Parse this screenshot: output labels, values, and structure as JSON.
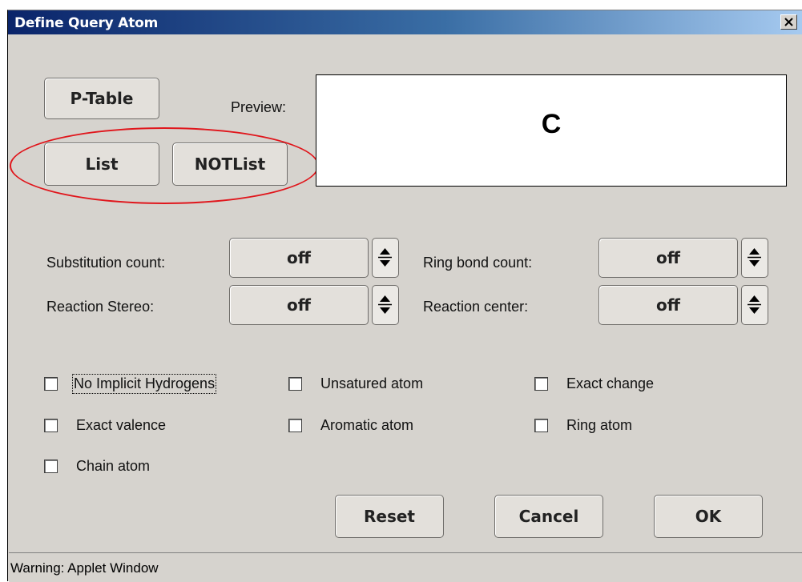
{
  "window": {
    "title": "Define Query Atom",
    "close_icon": "close-icon"
  },
  "buttons": {
    "ptable": "P-Table",
    "list": "List",
    "notlist": "NOTList",
    "reset": "Reset",
    "cancel": "Cancel",
    "ok": "OK"
  },
  "preview": {
    "label": "Preview:",
    "atom": "C"
  },
  "spinners": {
    "substitution_count": {
      "label": "Substitution count:",
      "value": "off"
    },
    "ring_bond_count": {
      "label": "Ring bond count:",
      "value": "off"
    },
    "reaction_stereo": {
      "label": "Reaction Stereo:",
      "value": "off"
    },
    "reaction_center": {
      "label": "Reaction center:",
      "value": "off"
    }
  },
  "checkboxes": {
    "no_implicit_hydrogens": {
      "label": "No Implicit Hydrogens",
      "checked": false
    },
    "unsatured_atom": {
      "label": "Unsatured atom",
      "checked": false
    },
    "exact_change": {
      "label": "Exact change",
      "checked": false
    },
    "exact_valence": {
      "label": "Exact valence",
      "checked": false
    },
    "aromatic_atom": {
      "label": "Aromatic atom",
      "checked": false
    },
    "ring_atom": {
      "label": "Ring atom",
      "checked": false
    },
    "chain_atom": {
      "label": "Chain atom",
      "checked": false
    }
  },
  "status": {
    "warning": "Warning: Applet Window"
  },
  "colors": {
    "title_gradient_start": "#0a246a",
    "title_gradient_end": "#a6caf0",
    "dialog_bg": "#d6d3ce",
    "highlight": "#e0161c"
  }
}
